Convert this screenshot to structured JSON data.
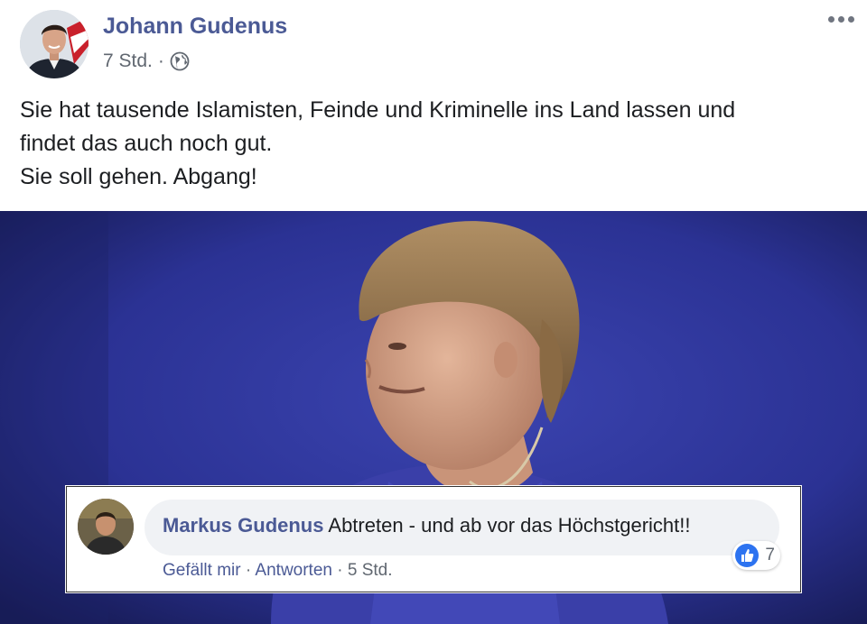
{
  "post": {
    "author": "Johann Gudenus",
    "time": "7 Std.",
    "separator": "·",
    "privacy_icon": "globe-icon",
    "more_icon": "ellipsis-icon",
    "text_lines": [
      "Sie hat tausende Islamisten, Feinde und Kriminelle ins Land lassen und",
      "findet das auch noch gut.",
      "Sie soll gehen. Abgang!"
    ]
  },
  "comment": {
    "author": "Markus Gudenus",
    "text": "Abtreten - und ab vor das Höchstgericht!!",
    "like_action": "Gefällt mir",
    "reply_action": "Antworten",
    "separator": "·",
    "time": "5 Std.",
    "reaction_icon": "like-icon",
    "reaction_count": "7"
  },
  "colors": {
    "name_blue": "#4b5a95",
    "photo_background": "#2a2f8f",
    "like_blue": "#2d73f0"
  }
}
